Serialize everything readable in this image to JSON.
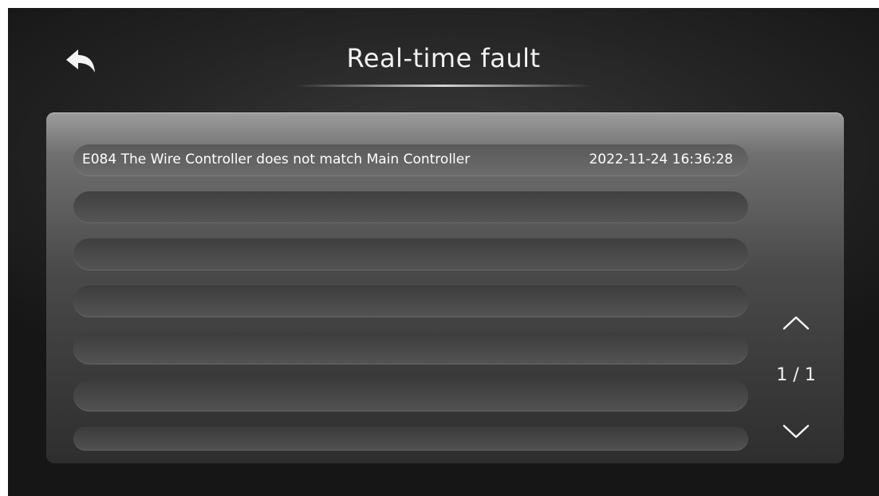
{
  "header": {
    "title": "Real-time fault",
    "back_icon": "back-arrow-icon"
  },
  "faults": [
    {
      "code_description": "E084 The Wire Controller does not match Main Controller",
      "timestamp": "2022-11-24 16:36:28"
    },
    {
      "code_description": "",
      "timestamp": ""
    },
    {
      "code_description": "",
      "timestamp": ""
    },
    {
      "code_description": "",
      "timestamp": ""
    },
    {
      "code_description": "",
      "timestamp": ""
    },
    {
      "code_description": "",
      "timestamp": ""
    },
    {
      "code_description": "",
      "timestamp": ""
    }
  ],
  "pager": {
    "indicator": "1 / 1",
    "up_icon": "chevron-up-icon",
    "down_icon": "chevron-down-icon"
  },
  "colors": {
    "background": "#1e1e1e",
    "text": "#ffffff",
    "row": "#5a5a5a"
  }
}
